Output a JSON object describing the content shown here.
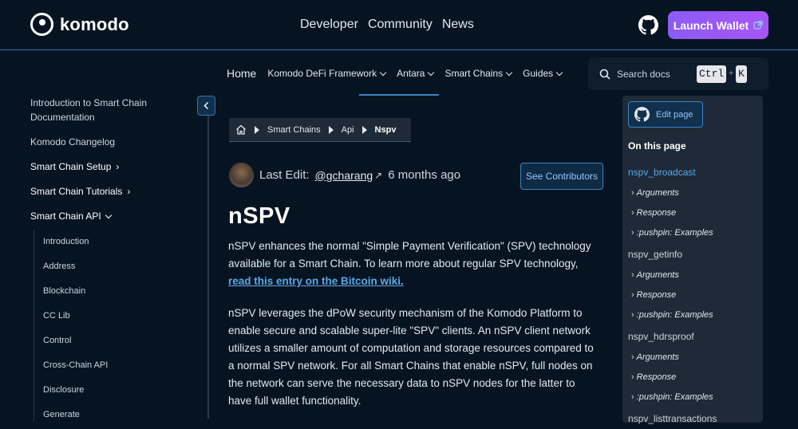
{
  "header": {
    "logo_text": "komodo",
    "nav": [
      "Developer",
      "Community",
      "News"
    ],
    "launch_label": "Launch Wallet"
  },
  "secondary_nav": {
    "items": [
      {
        "label": "Home"
      },
      {
        "label": "Komodo DeFi Framework"
      },
      {
        "label": "Antara"
      },
      {
        "label": "Smart Chains"
      },
      {
        "label": "Guides"
      }
    ],
    "search_placeholder": "Search docs",
    "key1": "Ctrl",
    "plus": "+",
    "key2": "K"
  },
  "sidebar": {
    "items": [
      "Introduction to Smart Chain Documentation",
      "Komodo Changelog",
      "Smart Chain Setup",
      "Smart Chain Tutorials",
      "Smart Chain API"
    ],
    "subitems": [
      "Introduction",
      "Address",
      "Blockchain",
      "CC Lib",
      "Control",
      "Cross-Chain API",
      "Disclosure",
      "Generate"
    ]
  },
  "breadcrumb": [
    "Smart Chains",
    "Api",
    "Nspv"
  ],
  "edit_info": {
    "prefix": "Last Edit:",
    "user": "@gcharang",
    "arrow": "↗",
    "time": "6 months ago",
    "contributors_label": "See Contributors"
  },
  "content": {
    "title": "nSPV",
    "para1": "nSPV enhances the normal \"Simple Payment Verification\" (SPV) technology available for a Smart Chain. To learn more about regular SPV technology,",
    "para1_link": "read this entry on the Bitcoin wiki.",
    "para2": "nSPV leverages the dPoW security mechanism of the Komodo Platform to enable secure and scalable super-lite \"SPV\" clients. An nSPV client network utilizes a smaller amount of computation and storage resources compared to a normal SPV network. For all Smart Chains that enable nSPV, full nodes on the network can serve the necessary data to nSPV nodes for the latter to have full wallet functionality."
  },
  "toc": {
    "edit_label": "Edit page",
    "heading": "On this page",
    "entries": [
      {
        "label": "nspv_broadcast",
        "subs": [
          "Arguments",
          "Response",
          ":pushpin: Examples"
        ]
      },
      {
        "label": "nspv_getinfo",
        "subs": [
          "Arguments",
          "Response",
          ":pushpin: Examples"
        ]
      },
      {
        "label": "nspv_hdrsproof",
        "subs": [
          "Arguments",
          "Response",
          ":pushpin: Examples"
        ]
      },
      {
        "label": "nspv_listtransactions",
        "subs": []
      }
    ]
  },
  "colors": {
    "accent": "#3b82c4",
    "launch": "#8b5cf6",
    "bg": "#061422"
  }
}
